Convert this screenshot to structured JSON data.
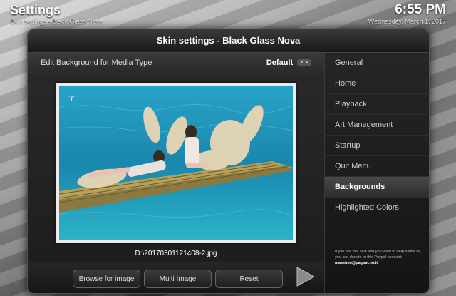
{
  "app": {
    "title": "Settings",
    "subtitle": "Skin settings - Black Glass Nova",
    "clock": "6:55 PM",
    "date": "Wednesday, March 1, 2017"
  },
  "dialog": {
    "title": "Skin settings - Black Glass Nova",
    "option": {
      "label": "Edit Background for Media Type",
      "value": "Default",
      "arrows_icon": "spin-arrows-icon"
    },
    "image_path": "D:\\20170301121408-2.jpg",
    "buttons": {
      "browse": "Browse for image",
      "multi": "Multi Image",
      "reset": "Reset"
    }
  },
  "sidebar": {
    "items": [
      {
        "label": "General"
      },
      {
        "label": "Home"
      },
      {
        "label": "Playback"
      },
      {
        "label": "Art Management"
      },
      {
        "label": "Startup"
      },
      {
        "label": "Quit Menu"
      },
      {
        "label": "Backgrounds",
        "active": true
      },
      {
        "label": "Highlighted Colors"
      }
    ],
    "donate_text": "If you like this skin and you want to help a little bit, you can donate to this Paypal account:",
    "donate_email": "massimo@pagani.no.it"
  },
  "colors": {
    "dialog_bg": "#111111",
    "accent_text": "#ffffff",
    "water": "#1f8fb5"
  }
}
